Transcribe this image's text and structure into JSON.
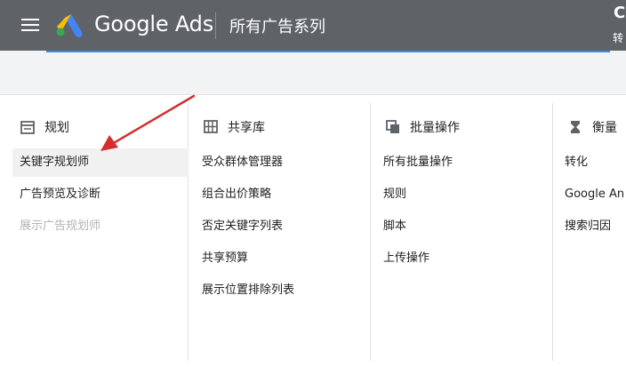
{
  "header": {
    "brand": "Google Ads",
    "page_title": "所有广告系列",
    "account_initial": "C",
    "account_sub": "转"
  },
  "colors": {
    "header_bg": "#5f6368",
    "accent_blue": "#4285f4",
    "arrow_red": "#d32f2f"
  },
  "columns": [
    {
      "title": "规划",
      "icon": "calendar-icon",
      "items": [
        {
          "label": "关键字规划师",
          "selected": true
        },
        {
          "label": "广告预览及诊断"
        },
        {
          "label": "展示广告规划师",
          "disabled": true
        }
      ]
    },
    {
      "title": "共享库",
      "icon": "grid-library-icon",
      "items": [
        {
          "label": "受众群体管理器"
        },
        {
          "label": "组合出价策略"
        },
        {
          "label": "否定关键字列表"
        },
        {
          "label": "共享预算"
        },
        {
          "label": "展示位置排除列表"
        }
      ]
    },
    {
      "title": "批量操作",
      "icon": "copy-stack-icon",
      "items": [
        {
          "label": "所有批量操作"
        },
        {
          "label": "规则"
        },
        {
          "label": "脚本"
        },
        {
          "label": "上传操作"
        }
      ]
    },
    {
      "title": "衡量",
      "icon": "hourglass-icon",
      "items": [
        {
          "label": "转化"
        },
        {
          "label": "Google An"
        },
        {
          "label": "搜索归因"
        }
      ]
    }
  ]
}
